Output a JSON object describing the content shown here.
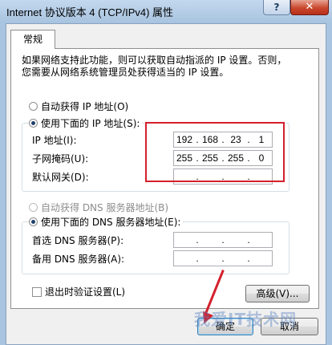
{
  "window": {
    "title": "Internet 协议版本 4 (TCP/IPv4) 属性",
    "help_label": "?",
    "close_label": "✕"
  },
  "tabs": [
    {
      "label": "常规"
    }
  ],
  "intro": {
    "line1": "如果网络支持此功能，则可以获取自动指派的 IP 设置。否则，",
    "line2": "您需要从网络系统管理员处获得适当的 IP 设置。"
  },
  "ip": {
    "auto_label": "自动获得 IP 地址(O)",
    "manual_label": "使用下面的 IP 地址(S):",
    "selected": "manual",
    "ip_label": "IP 地址(I):",
    "mask_label": "子网掩码(U):",
    "gateway_label": "默认网关(D):",
    "ip_value": [
      "192",
      "168",
      "23",
      "1"
    ],
    "mask_value": [
      "255",
      "255",
      "255",
      "0"
    ],
    "gateway_value": [
      "",
      "",
      "",
      ""
    ]
  },
  "dns": {
    "auto_label": "自动获得 DNS 服务器地址(B)",
    "manual_label": "使用下面的 DNS 服务器地址(E):",
    "selected": "manual",
    "preferred_label": "首选 DNS 服务器(P):",
    "alternate_label": "备用 DNS 服务器(A):",
    "preferred_value": [
      "",
      "",
      "",
      ""
    ],
    "alternate_value": [
      "",
      "",
      "",
      ""
    ]
  },
  "validate_on_exit": {
    "label": "退出时验证设置(L)",
    "checked": false
  },
  "buttons": {
    "advanced": "高级(V)...",
    "ok": "确定",
    "cancel": "取消"
  },
  "watermark": "我爱IT技术网",
  "colors": {
    "highlight": "#d4202c",
    "frame": "#a9c4e0"
  }
}
